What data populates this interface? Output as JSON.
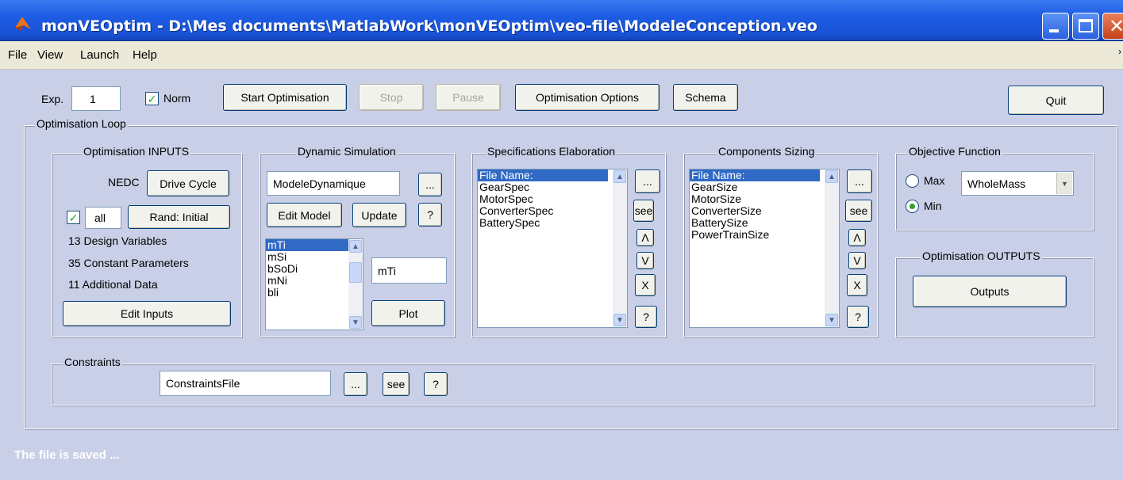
{
  "window": {
    "title": "monVEOptim - D:\\Mes documents\\MatlabWork\\monVEOptim\\veo-file\\ModeleConception.veo"
  },
  "menu": {
    "items": [
      "File",
      "View",
      "Launch",
      "Help"
    ]
  },
  "toolbar": {
    "exp_label": "Exp.",
    "exp_value": "1",
    "norm_label": "Norm",
    "norm_checked": true,
    "start_label": "Start Optimisation",
    "stop_label": "Stop",
    "pause_label": "Pause",
    "options_label": "Optimisation Options",
    "schema_label": "Schema",
    "quit_label": "Quit"
  },
  "loop": {
    "title": "Optimisation Loop",
    "inputs": {
      "title": "Optimisation INPUTS",
      "nedc_label": "NEDC",
      "drive_cycle_label": "Drive Cycle",
      "all_label": "all",
      "rand_label": "Rand: Initial",
      "design_vars": "13 Design Variables",
      "const_params": "35 Constant Parameters",
      "add_data": "11 Additional Data",
      "edit_inputs_label": "Edit Inputs"
    },
    "dynamic": {
      "title": "Dynamic Simulation",
      "model_value": "ModeleDynamique",
      "browse_label": "...",
      "edit_model_label": "Edit Model",
      "update_label": "Update",
      "help_label": "?",
      "variables": [
        "mTi",
        "mSi",
        "bSoDi",
        "mNi",
        "bli"
      ],
      "selected_variable": "mTi",
      "plot_label": "Plot"
    },
    "specs": {
      "title": "Specifications Elaboration",
      "items": [
        "File Name:",
        "GearSpec",
        "MotorSpec",
        "ConverterSpec",
        "BatterySpec"
      ],
      "buttons": [
        "...",
        "see",
        "Λ",
        "V",
        "X",
        "?"
      ]
    },
    "sizing": {
      "title": "Components Sizing",
      "items": [
        "File Name:",
        "GearSize",
        "MotorSize",
        "ConverterSize",
        "BatterySize",
        "PowerTrainSize"
      ],
      "buttons": [
        "...",
        "see",
        "Λ",
        "V",
        "X",
        "?"
      ]
    },
    "objective": {
      "title": "Objective Function",
      "max_label": "Max",
      "min_label": "Min",
      "selected": "Min",
      "function_value": "WholeMass"
    },
    "outputs": {
      "title": "Optimisation OUTPUTS",
      "button_label": "Outputs"
    },
    "constraints": {
      "title": "Constraints",
      "file_value": "ConstraintsFile",
      "browse_label": "...",
      "see_label": "see",
      "help_label": "?"
    }
  },
  "status": "The file is saved ..."
}
